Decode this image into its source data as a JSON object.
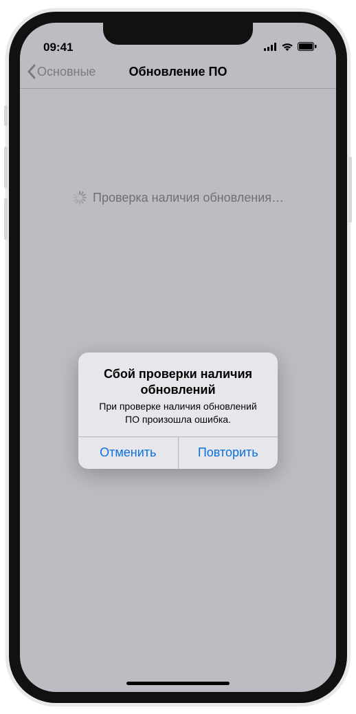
{
  "status_bar": {
    "time": "09:41"
  },
  "nav": {
    "back_label": "Основные",
    "title": "Обновление ПО"
  },
  "loading_text": "Проверка наличия обновления…",
  "alert": {
    "title": "Сбой проверки наличия обновлений",
    "message": "При проверке наличия обновлений ПО произошла ошибка.",
    "cancel": "Отменить",
    "retry": "Повторить"
  }
}
